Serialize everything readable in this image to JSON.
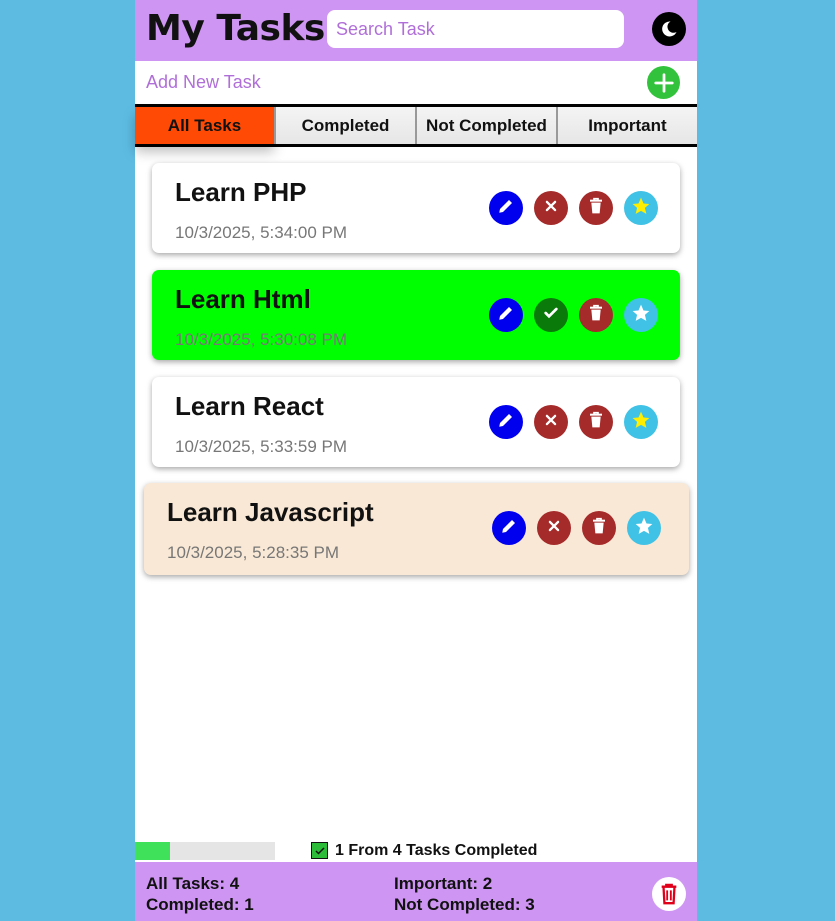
{
  "header": {
    "title": "My Tasks",
    "search_placeholder": "Search Task",
    "theme_icon": "moon-icon"
  },
  "add_task": {
    "placeholder": "Add New Task",
    "button_icon": "plus-icon"
  },
  "tabs": [
    {
      "label": "All Tasks",
      "active": true
    },
    {
      "label": "Completed",
      "active": false
    },
    {
      "label": "Not Completed",
      "active": false
    },
    {
      "label": "Important",
      "active": false
    }
  ],
  "tasks": [
    {
      "name": "Learn PHP",
      "date": "10/3/2025, 5:34:00 PM",
      "completed": false,
      "important": true,
      "bg": "#ffffff"
    },
    {
      "name": "Learn Html",
      "date": "10/3/2025, 5:30:08 PM",
      "completed": true,
      "important": false,
      "bg": "#00ff00"
    },
    {
      "name": "Learn React",
      "date": "10/3/2025, 5:33:59 PM",
      "completed": false,
      "important": true,
      "bg": "#ffffff"
    },
    {
      "name": "Learn Javascript",
      "date": "10/3/2025, 5:28:35 PM",
      "completed": false,
      "important": false,
      "bg": "#f9e8d5"
    }
  ],
  "progress": {
    "completed": 1,
    "total": 4,
    "fraction": 0.25,
    "text": "1 From 4 Tasks Completed"
  },
  "footer": {
    "all_tasks": "All Tasks: 4",
    "completed": "Completed: 1",
    "important": "Important: 2",
    "not_completed": "Not Completed: 3"
  },
  "colors": {
    "header_bg": "#cf95f2",
    "page_bg": "#5dbbe2",
    "active_tab": "#ff4a05",
    "edit": "#0000ee",
    "complete_off": "#a52a2a",
    "complete_on": "#0a7a0a",
    "delete": "#a52a2a",
    "star_bg": "#40c2e6",
    "star_on": "#ffee00",
    "add": "#33c23b"
  }
}
